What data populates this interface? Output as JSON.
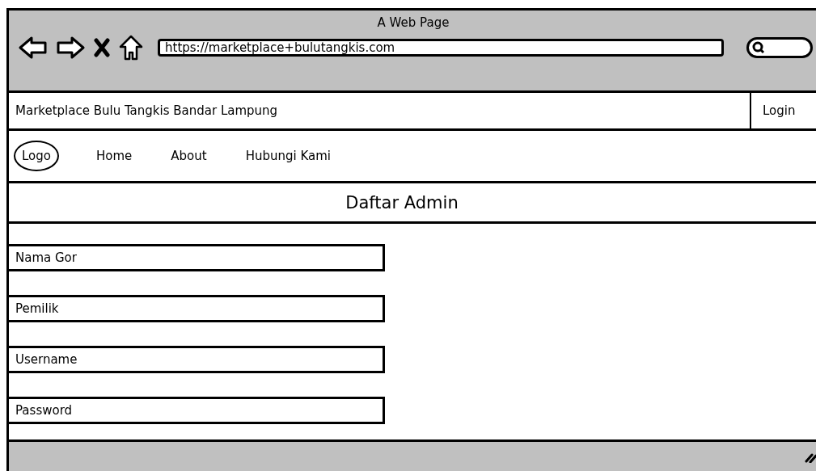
{
  "window": {
    "title": "A Web Page"
  },
  "browser": {
    "url": "https://marketplace+bulutangkis.com"
  },
  "header": {
    "site_name": "Marketplace Bulu Tangkis Bandar Lampung",
    "login": "Login"
  },
  "nav": {
    "logo": "Logo",
    "links": [
      "Home",
      "About",
      "Hubungi Kami"
    ]
  },
  "page_title": "Daftar Admin",
  "fields": [
    {
      "value": "Nama Gor"
    },
    {
      "value": "Pemilik"
    },
    {
      "value": "Username"
    },
    {
      "value": "Password"
    }
  ]
}
